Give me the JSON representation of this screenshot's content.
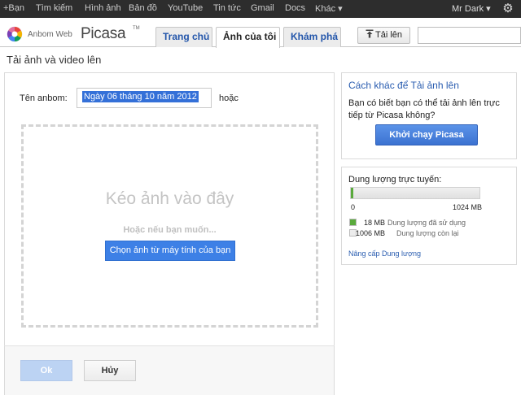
{
  "gbar": {
    "items": [
      "+Bạn",
      "Tìm kiếm",
      "Hình ảnh",
      "Bản đồ",
      "YouTube",
      "Tin tức",
      "Gmail",
      "Docs",
      "Khác ▾"
    ],
    "user": "Mr Dark ▾",
    "settings_icon": "gear-icon"
  },
  "header": {
    "logo_prefix": "Anbom Web",
    "logo_word": "Picasa",
    "logo_tm": "TM",
    "tabs": [
      {
        "label": "Trang chủ",
        "active": false
      },
      {
        "label": "Ảnh của tôi",
        "active": true
      },
      {
        "label": "Khám phá",
        "active": false
      }
    ],
    "upload_label": "Tải lên",
    "upload_icon": "upload-icon"
  },
  "page": {
    "title": "Tải ảnh và video lên"
  },
  "upload_form": {
    "album_label": "Tên anbom:",
    "album_value": "Ngày 06 tháng 10 năm 2012",
    "or_label": "hoặc",
    "drop_title": "Kéo ảnh vào đây",
    "drop_hint": "Hoặc nếu bạn muốn...",
    "choose_label": "Chọn ảnh từ máy tính của bạn",
    "ok_label": "Ok",
    "cancel_label": "Hủy"
  },
  "alt_upload": {
    "title": "Cách khác để Tải ảnh lên",
    "text": "Bạn có biết bạn có thể tải ảnh lên trực tiếp từ Picasa không?",
    "button_label": "Khởi chạy Picasa"
  },
  "storage": {
    "title": "Dung lượng trực tuyến:",
    "used_fraction": 0.018,
    "min_label": "0",
    "max_label": "1024 MB",
    "used_value": "18 MB",
    "used_label": "Dung lượng đã sử dụng",
    "free_value": "1006 MB",
    "free_label": "Dung lượng còn lại",
    "upgrade_label": "Nâng cấp Dung lượng",
    "colors": {
      "used": "#5aaa3c",
      "free": "#ececec"
    }
  }
}
